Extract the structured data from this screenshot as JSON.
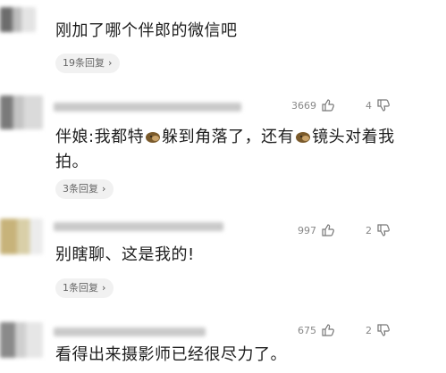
{
  "comments": [
    {
      "text": "刚加了哪个伴郎的微信吧",
      "replies_label": "19条回复",
      "likes": "",
      "dislikes": "",
      "avatar_color": "#8e8e8e"
    },
    {
      "text_parts": [
        "伴娘:我都特",
        "躲到角落了，还有",
        "镜头对着我拍。"
      ],
      "replies_label": "3条回复",
      "likes": "3669",
      "dislikes": "4",
      "avatar_color": "#9b9b9b"
    },
    {
      "text": "别瞎聊、这是我的!",
      "replies_label": "1条回复",
      "likes": "997",
      "dislikes": "2",
      "avatar_color": "#b8a46a"
    },
    {
      "text": "看得出来摄影师已经很尽力了。",
      "replies_label": "",
      "likes": "675",
      "dislikes": "2",
      "avatar_color": "#a0a0a0"
    }
  ],
  "icons": {
    "replies_chevron": "›",
    "like": "thumbs-up-icon",
    "dislike": "thumbs-down-icon",
    "emoji": "dog-face-emoji"
  },
  "colors": {
    "reply_pill_bg": "#f1f1f1",
    "meta_text": "#888888"
  }
}
